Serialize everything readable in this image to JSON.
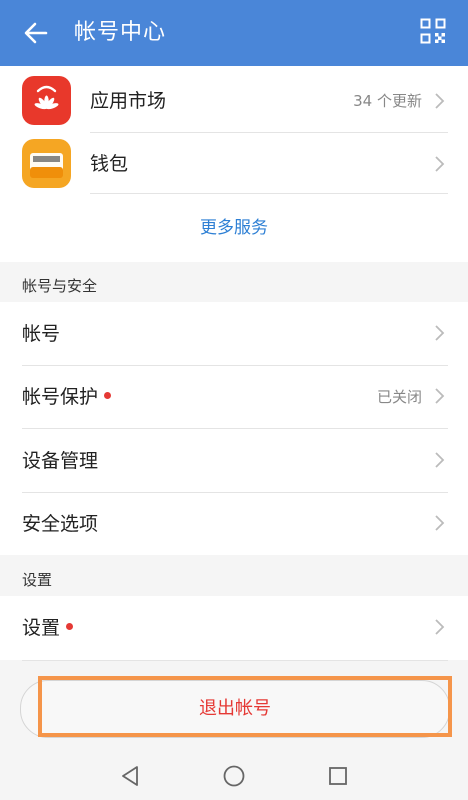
{
  "header": {
    "title": "帐号中心"
  },
  "services": [
    {
      "label": "应用市场",
      "badge": "34 个更新",
      "icon": "huawei-appgallery-icon"
    },
    {
      "label": "钱包",
      "icon": "wallet-icon"
    }
  ],
  "more_services": "更多服务",
  "security_section": {
    "title": "帐号与安全",
    "items": [
      {
        "label": "帐号"
      },
      {
        "label": "帐号保护",
        "status": "已关闭"
      },
      {
        "label": "设备管理"
      },
      {
        "label": "安全选项"
      }
    ]
  },
  "settings_section": {
    "title": "设置",
    "items": [
      {
        "label": "设置"
      }
    ]
  },
  "logout_label": "退出帐号",
  "colors": {
    "header": "#4a86d8",
    "link": "#2d7fd4",
    "danger": "#e53935",
    "highlight": "#f5954a"
  }
}
